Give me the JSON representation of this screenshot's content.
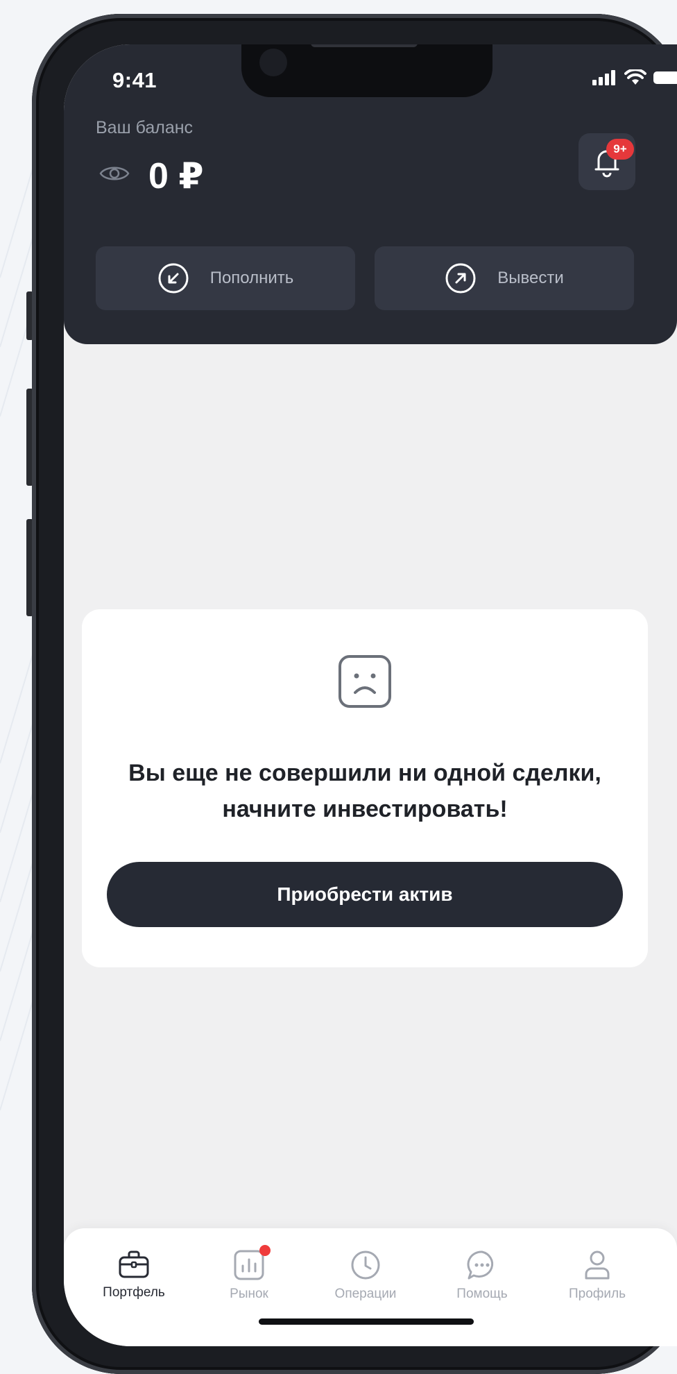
{
  "status_bar": {
    "time": "9:41"
  },
  "header": {
    "balance_label": "Ваш баланс",
    "balance_amount": "0 ₽",
    "notification_badge": "9+",
    "actions": [
      {
        "label": "Пополнить",
        "icon": "arrow-down-left-circle-icon"
      },
      {
        "label": "Вывести",
        "icon": "arrow-up-right-circle-icon"
      }
    ]
  },
  "empty_state": {
    "icon": "sad-face-icon",
    "message_line1": "Вы еще не совершили ни одной сделки,",
    "message_line2": "начните инвестировать!",
    "cta_label": "Приобрести актив"
  },
  "tabbar": {
    "items": [
      {
        "label": "Портфель",
        "icon": "briefcase-icon",
        "active": true
      },
      {
        "label": "Рынок",
        "icon": "chart-icon",
        "has_dot": true
      },
      {
        "label": "Операции",
        "icon": "clock-icon"
      },
      {
        "label": "Помощь",
        "icon": "chat-icon"
      },
      {
        "label": "Профиль",
        "icon": "user-icon"
      }
    ]
  },
  "colors": {
    "header_bg": "#272a33",
    "accent_red": "#e5383b",
    "screen_bg": "#f0f0f1"
  }
}
